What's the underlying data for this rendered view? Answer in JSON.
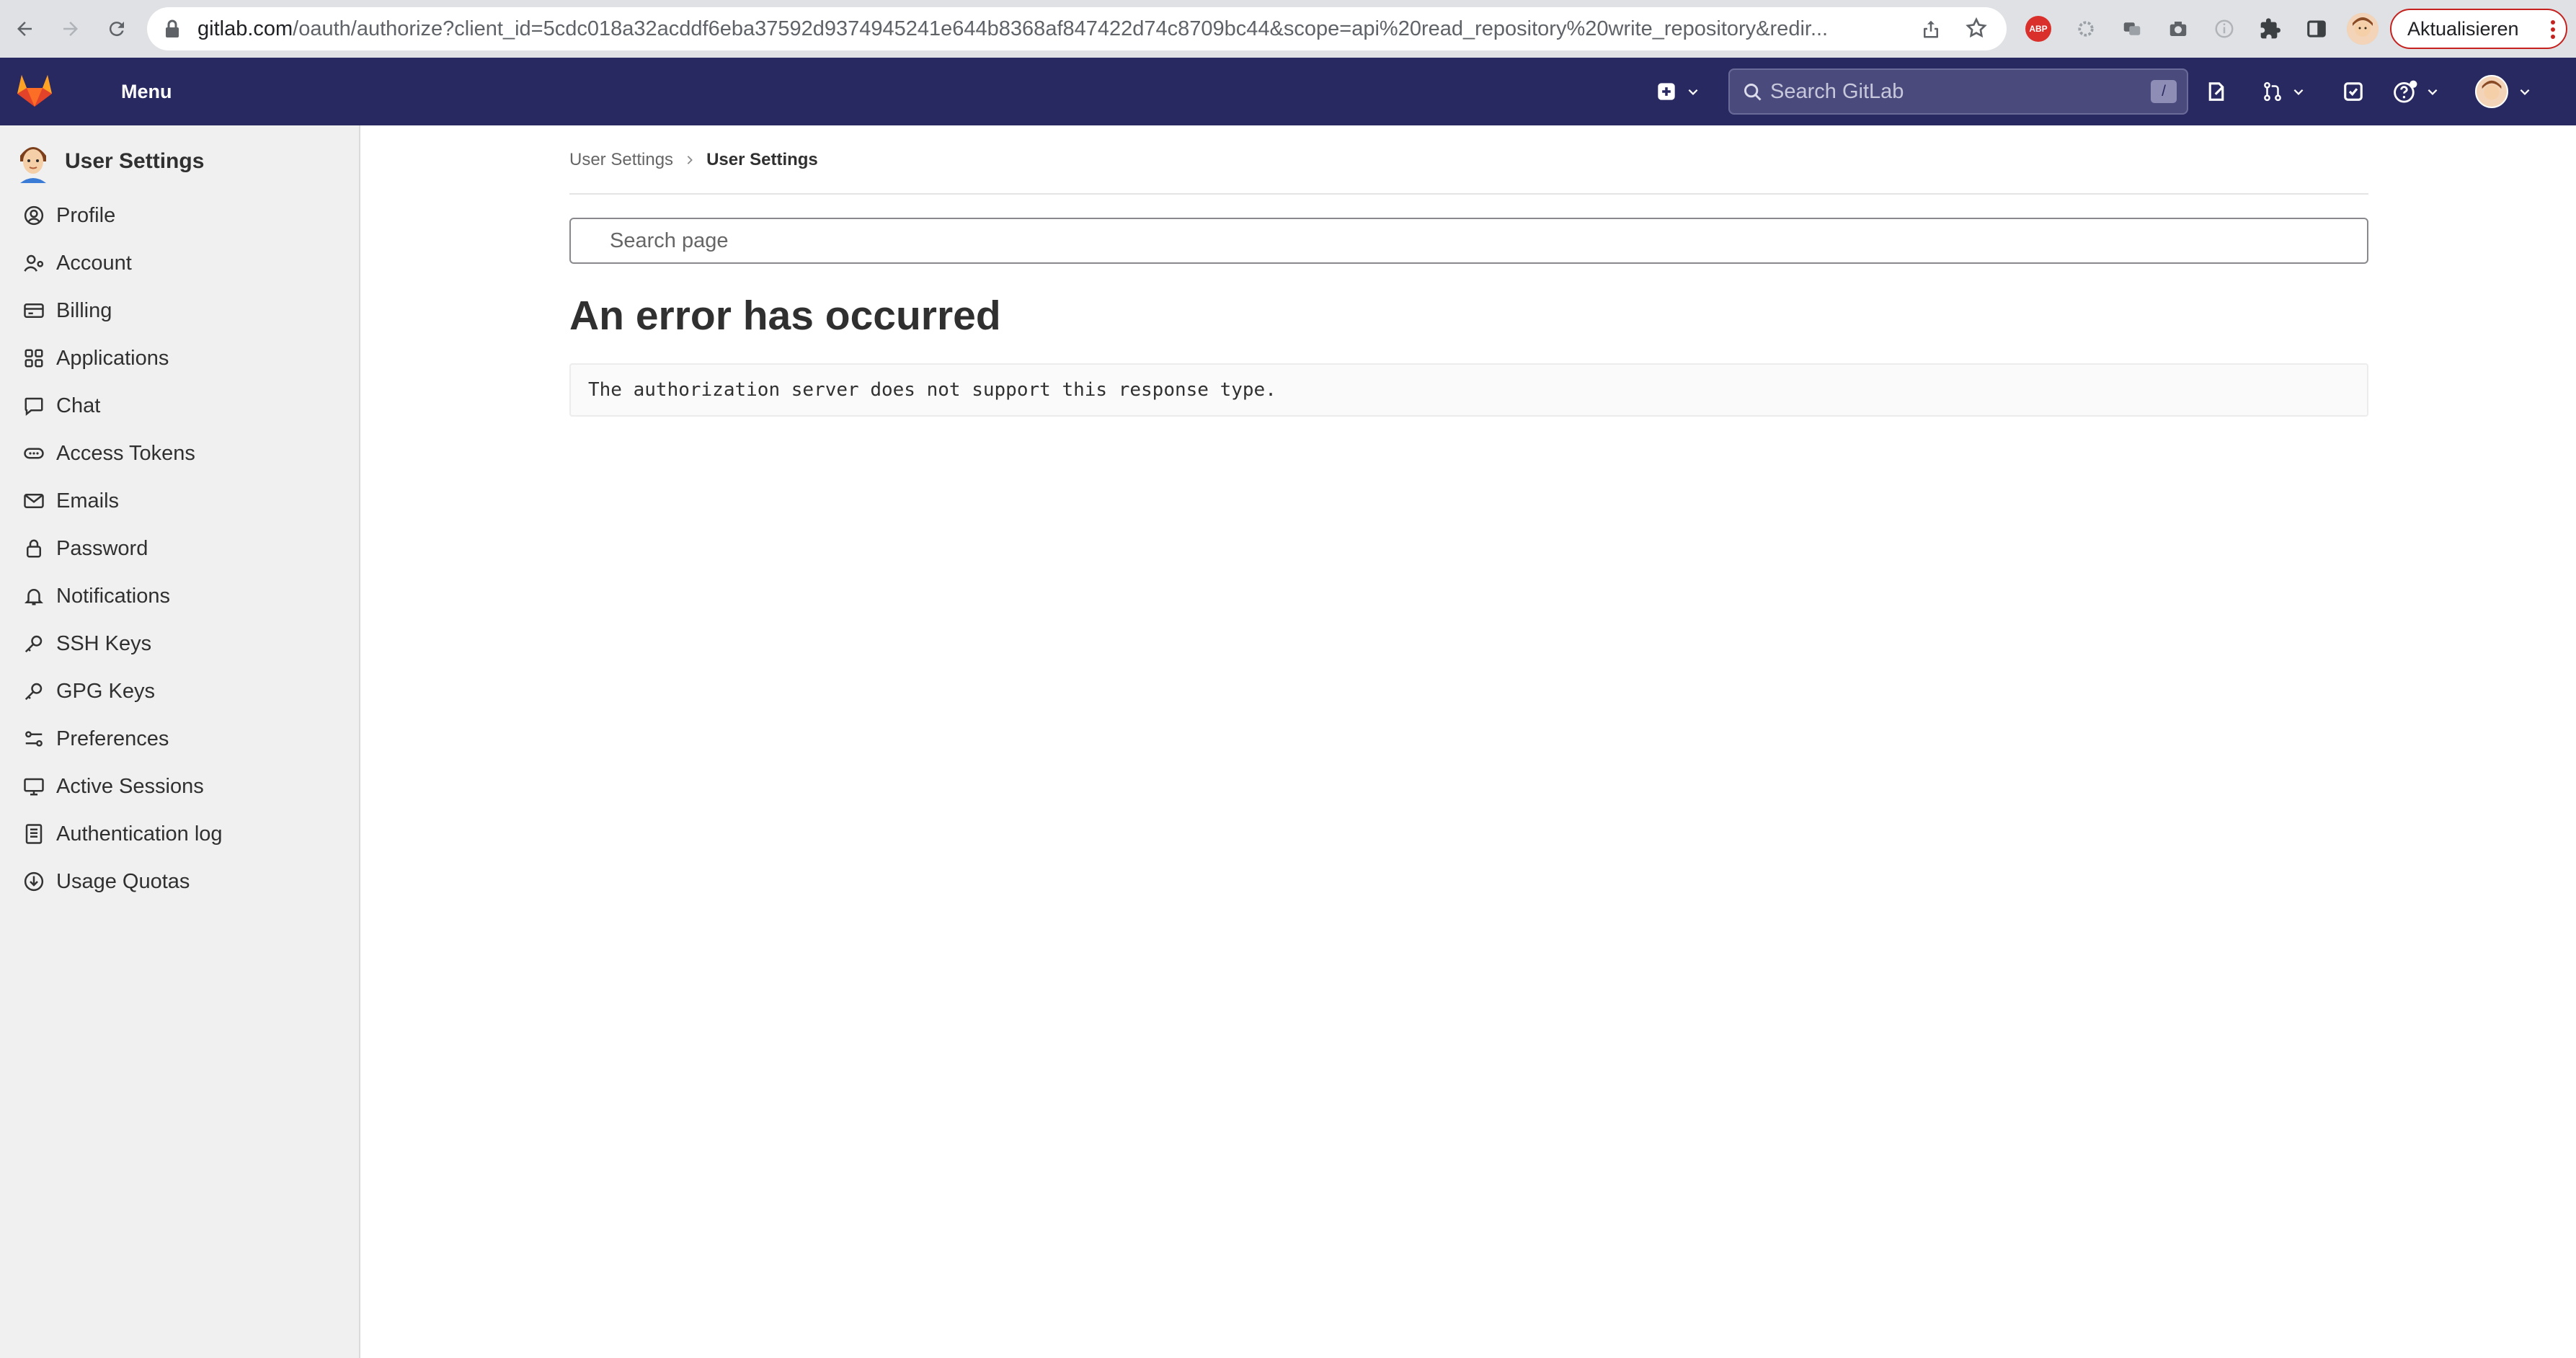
{
  "browser": {
    "url_host": "gitlab.com",
    "url_path": "/oauth/authorize?client_id=5cdc018a32acddf6eba37592d9374945241e644b8368af847422d74c8709bc44&scope=api%20read_repository%20write_repository&redir...",
    "abp_label": "ABP",
    "update_label": "Aktualisieren"
  },
  "topbar": {
    "menu_label": "Menu",
    "search_placeholder": "Search GitLab",
    "search_shortcut": "/"
  },
  "sidebar": {
    "title": "User Settings",
    "items": [
      {
        "label": "Profile",
        "icon": "profile-icon"
      },
      {
        "label": "Account",
        "icon": "account-icon"
      },
      {
        "label": "Billing",
        "icon": "billing-icon"
      },
      {
        "label": "Applications",
        "icon": "applications-icon"
      },
      {
        "label": "Chat",
        "icon": "chat-icon"
      },
      {
        "label": "Access Tokens",
        "icon": "token-icon"
      },
      {
        "label": "Emails",
        "icon": "mail-icon"
      },
      {
        "label": "Password",
        "icon": "lock-icon"
      },
      {
        "label": "Notifications",
        "icon": "bell-icon"
      },
      {
        "label": "SSH Keys",
        "icon": "key-icon"
      },
      {
        "label": "GPG Keys",
        "icon": "key-icon"
      },
      {
        "label": "Preferences",
        "icon": "preferences-icon"
      },
      {
        "label": "Active Sessions",
        "icon": "monitor-icon"
      },
      {
        "label": "Authentication log",
        "icon": "log-icon"
      },
      {
        "label": "Usage Quotas",
        "icon": "quota-icon"
      }
    ]
  },
  "main": {
    "breadcrumb": [
      "User Settings",
      "User Settings"
    ],
    "search_placeholder": "Search page",
    "error_title": "An error has occurred",
    "error_message": "The authorization server does not support this response type."
  },
  "colors": {
    "topbar_bg": "#292961",
    "sidebar_bg": "#f0f0f0",
    "gitlab_orange": "#fc6d26",
    "update_border": "#c5221f"
  }
}
